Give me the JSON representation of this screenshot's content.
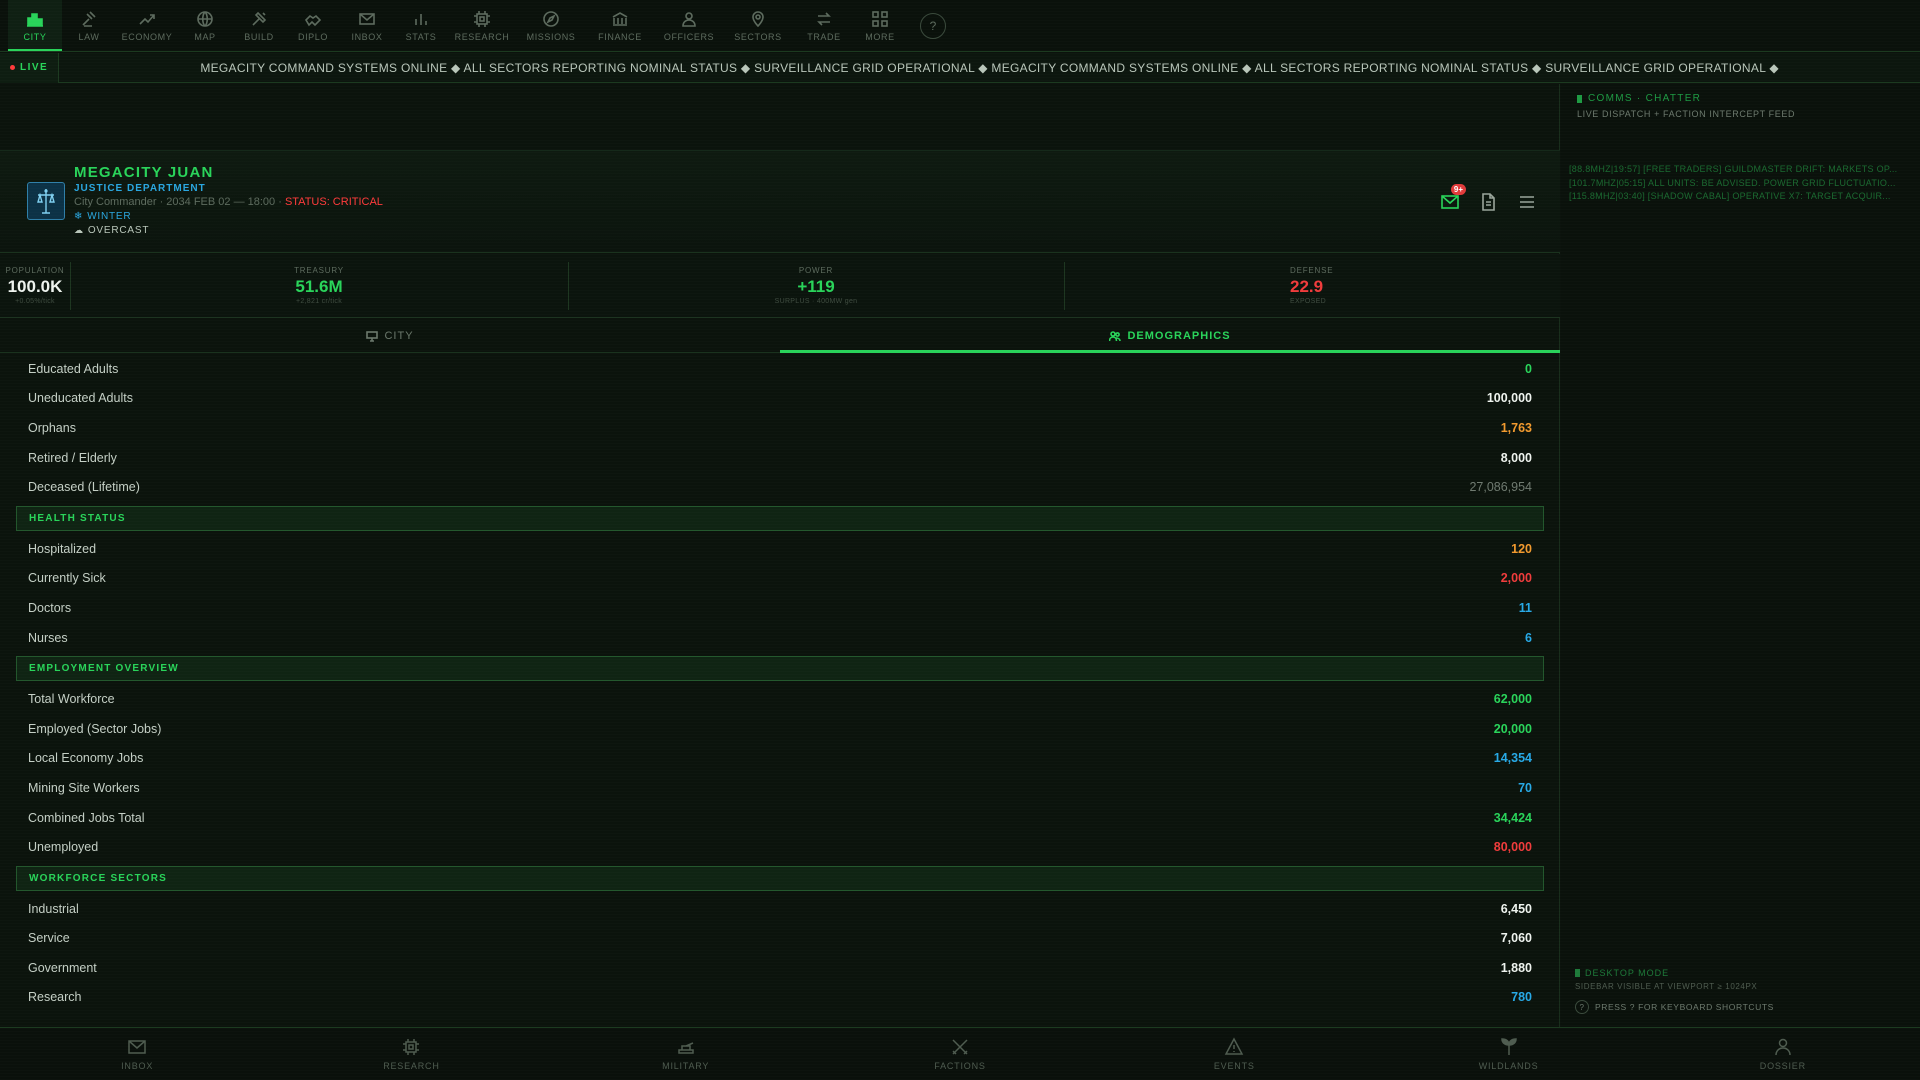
{
  "top_nav": [
    {
      "label": "CITY",
      "icon": "city-icon",
      "active": true
    },
    {
      "label": "LAW",
      "icon": "gavel-icon"
    },
    {
      "label": "ECONOMY",
      "icon": "trend-icon"
    },
    {
      "label": "MAP",
      "icon": "globe-icon"
    },
    {
      "label": "BUILD",
      "icon": "hammer-icon"
    },
    {
      "label": "DIPLO",
      "icon": "handshake-icon"
    },
    {
      "label": "INBOX",
      "icon": "mail-icon"
    },
    {
      "label": "STATS",
      "icon": "bar-chart-icon"
    },
    {
      "label": "RESEARCH",
      "icon": "chip-icon"
    },
    {
      "label": "MISSIONS",
      "icon": "compass-icon"
    },
    {
      "label": "FINANCE",
      "icon": "bank-icon"
    },
    {
      "label": "OFFICERS",
      "icon": "officer-icon"
    },
    {
      "label": "SECTORS",
      "icon": "pin-icon"
    },
    {
      "label": "TRADE",
      "icon": "exchange-icon"
    },
    {
      "label": "MORE",
      "icon": "grid-icon"
    }
  ],
  "help_label": "?",
  "ticker": {
    "live_label": "LIVE",
    "text": "MEGACITY COMMAND SYSTEMS ONLINE ◆ ALL SECTORS REPORTING NOMINAL STATUS ◆ SURVEILLANCE GRID OPERATIONAL ◆ MEGACITY COMMAND SYSTEMS ONLINE ◆ ALL SECTORS REPORTING NOMINAL STATUS ◆ SURVEILLANCE GRID OPERATIONAL ◆"
  },
  "city": {
    "name": "MEGACITY JUAN",
    "department": "JUSTICE DEPARTMENT",
    "meta": "City Commander · 2034 FEB 02 — 18:00 · ",
    "status": "STATUS: CRITICAL",
    "season": "WINTER",
    "weather": "OVERCAST",
    "mail_badge": "9+"
  },
  "stats": {
    "population": {
      "label": "POPULATION",
      "value": "100.0K",
      "sub": "+0.05%/tick"
    },
    "treasury": {
      "label": "TREASURY",
      "value": "51.6M",
      "sub": "+2,821 cr/tick"
    },
    "power": {
      "label": "POWER",
      "value": "+119",
      "sub": "SURPLUS · 400MW gen"
    },
    "defense": {
      "label": "DEFENSE",
      "value": "22.9",
      "sub": "EXPOSED"
    }
  },
  "tabs": {
    "city": "CITY",
    "demographics": "DEMOGRAPHICS"
  },
  "rows_top": [
    {
      "k": "Educated Adults",
      "v": "0",
      "c": "green"
    },
    {
      "k": "Uneducated Adults",
      "v": "100,000",
      "c": "white"
    },
    {
      "k": "Orphans",
      "v": "1,763",
      "c": "orange"
    },
    {
      "k": "Retired / Elderly",
      "v": "8,000",
      "c": "white"
    },
    {
      "k": "Deceased (Lifetime)",
      "v": "27,086,954",
      "c": "gray"
    }
  ],
  "health": {
    "title": "HEALTH STATUS",
    "rows": [
      {
        "k": "Hospitalized",
        "v": "120",
        "c": "orange"
      },
      {
        "k": "Currently Sick",
        "v": "2,000",
        "c": "red"
      },
      {
        "k": "Doctors",
        "v": "11",
        "c": "blue"
      },
      {
        "k": "Nurses",
        "v": "6",
        "c": "blue"
      }
    ]
  },
  "employment": {
    "title": "EMPLOYMENT OVERVIEW",
    "rows": [
      {
        "k": "Total Workforce",
        "v": "62,000",
        "c": "green"
      },
      {
        "k": "Employed (Sector Jobs)",
        "v": "20,000",
        "c": "green"
      },
      {
        "k": "Local Economy Jobs",
        "v": "14,354",
        "c": "blue"
      },
      {
        "k": "Mining Site Workers",
        "v": "70",
        "c": "blue"
      },
      {
        "k": "Combined Jobs Total",
        "v": "34,424",
        "c": "green"
      },
      {
        "k": "Unemployed",
        "v": "80,000",
        "c": "red"
      }
    ]
  },
  "workforce": {
    "title": "WORKFORCE SECTORS",
    "rows": [
      {
        "k": "Industrial",
        "v": "6,450",
        "c": "white"
      },
      {
        "k": "Service",
        "v": "7,060",
        "c": "white"
      },
      {
        "k": "Government",
        "v": "1,880",
        "c": "white"
      },
      {
        "k": "Research",
        "v": "780",
        "c": "blue"
      }
    ]
  },
  "side": {
    "title": "COMMS · CHATTER",
    "subtitle": "LIVE DISPATCH + FACTION INTERCEPT FEED",
    "chatter": [
      "[88.8MHZ|19:57] [FREE TRADERS] GUILDMASTER DRIFT: MARKETS OP...",
      "[101.7MHZ|05:15] ALL UNITS: BE ADVISED. POWER GRID FLUCTUATIO...",
      "[115.8MHZ|03:40] [SHADOW CABAL] OPERATIVE X7: TARGET ACQUIR..."
    ],
    "desktop_mode": "DESKTOP MODE",
    "desktop_sub": "SIDEBAR VISIBLE AT VIEWPORT ≥ 1024PX",
    "shortcut_hint": "PRESS ? FOR KEYBOARD SHORTCUTS"
  },
  "bottom_nav": [
    {
      "label": "INBOX",
      "icon": "mail-icon"
    },
    {
      "label": "RESEARCH",
      "icon": "chip-icon"
    },
    {
      "label": "MILITARY",
      "icon": "tank-icon"
    },
    {
      "label": "FACTIONS",
      "icon": "swords-icon"
    },
    {
      "label": "EVENTS",
      "icon": "warning-icon"
    },
    {
      "label": "WILDLANDS",
      "icon": "leaf-icon"
    },
    {
      "label": "DOSSIER",
      "icon": "person-icon"
    }
  ],
  "colors": {
    "accent_green": "#29d45a",
    "accent_blue": "#27a9e6",
    "critical_red": "#f03c3c",
    "warning_orange": "#f29a2e",
    "background": "#0b120c"
  }
}
